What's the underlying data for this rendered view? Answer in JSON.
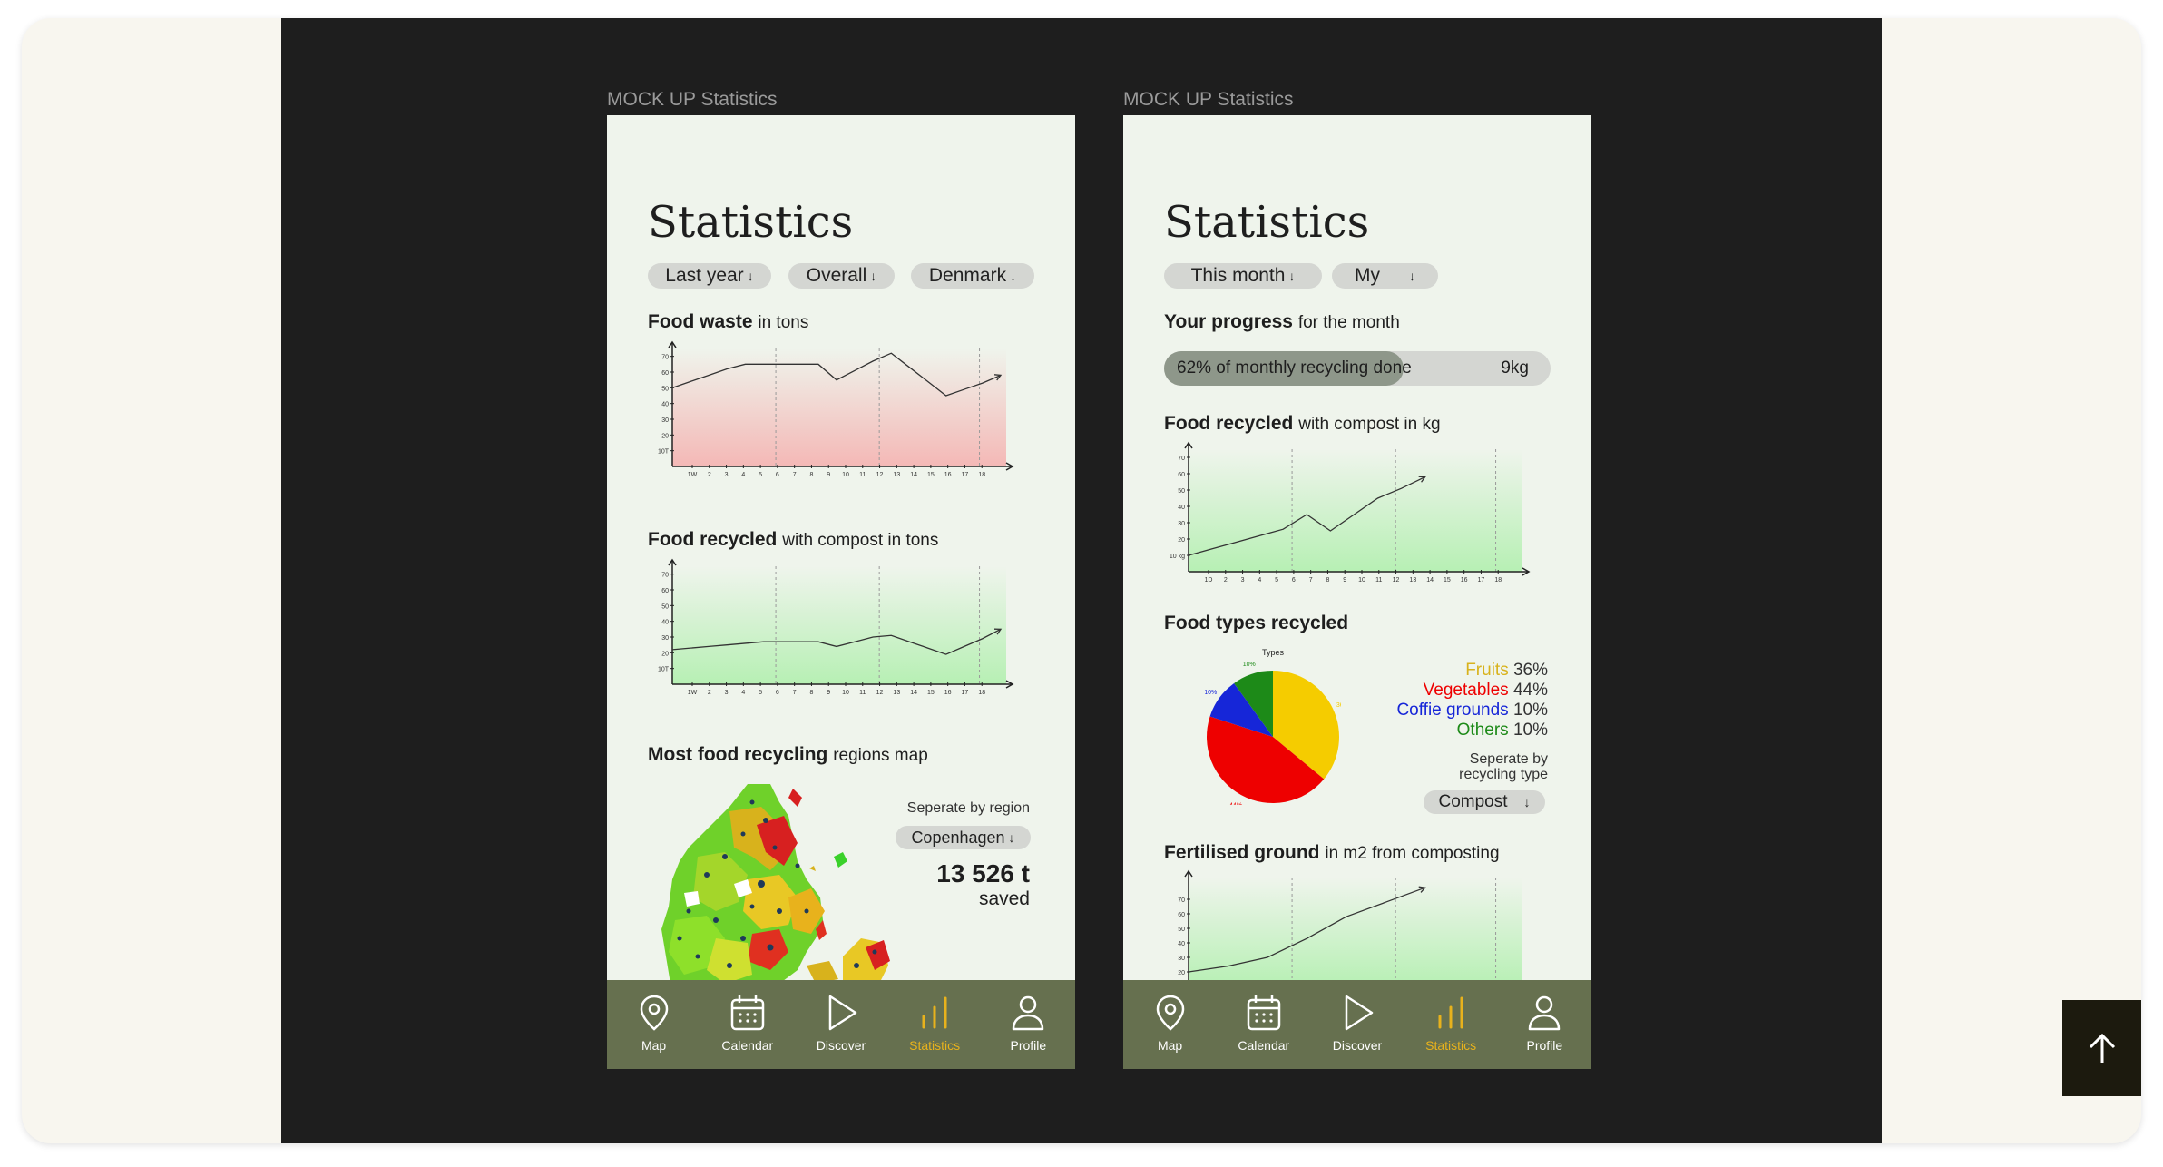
{
  "frame_label_left": "MOCK UP Statistics",
  "frame_label_right": "MOCK UP Statistics",
  "left": {
    "title": "Statistics",
    "filters": [
      "Last year",
      "Overall",
      "Denmark"
    ],
    "food_waste": {
      "title": "Food waste",
      "sub": "in tons"
    },
    "food_recycled": {
      "title": "Food recycled",
      "sub": "with compost in tons"
    },
    "map_section": {
      "title": "Most food recycling",
      "sub": "regions map",
      "separate_label": "Seperate by region",
      "region": "Copenhagen",
      "amount": "13 526 t",
      "amount_sub": "saved"
    }
  },
  "right": {
    "title": "Statistics",
    "filters": [
      "This month",
      "My"
    ],
    "progress": {
      "title": "Your progress",
      "sub": "for the month",
      "text": "62% of monthly recycling done",
      "value": "9kg",
      "percent": 62
    },
    "food_recycled": {
      "title": "Food recycled",
      "sub": "with compost in kg"
    },
    "food_types": {
      "title": "Food types recycled",
      "pie_title": "Types",
      "separate_label_1": "Seperate by",
      "separate_label_2": "recycling type",
      "select": "Compost"
    },
    "fertilised": {
      "title": "Fertilised ground",
      "sub": "in m2 from composting"
    }
  },
  "arrows": "↓",
  "tabs": [
    {
      "label": "Map",
      "icon": "map-pin-icon"
    },
    {
      "label": "Calendar",
      "icon": "calendar-icon"
    },
    {
      "label": "Discover",
      "icon": "play-icon"
    },
    {
      "label": "Statistics",
      "icon": "bar-chart-icon"
    },
    {
      "label": "Profile",
      "icon": "user-icon"
    }
  ],
  "colors": {
    "stage": "#1e1e1e",
    "phone": "#eff4ec",
    "tabbar": "#66704f",
    "active": "#e8b21c",
    "waste_fill": "#f4b8b6",
    "recycle_fill": "#b7f0b4"
  },
  "chart_data": [
    {
      "type": "area",
      "title": "Food waste",
      "ylabel": "",
      "yticks": [
        "10T",
        "20",
        "30",
        "40",
        "50",
        "60",
        "70"
      ],
      "x": [
        "1W",
        "2",
        "3",
        "4",
        "5",
        "6",
        "7",
        "8",
        "9",
        "10",
        "11",
        "12",
        "13",
        "14",
        "15",
        "16",
        "17",
        "18"
      ],
      "series": [
        {
          "values": [
            50,
            54,
            58,
            62,
            65,
            65,
            65,
            65,
            65,
            55,
            61,
            67,
            72,
            63,
            54,
            45,
            49,
            53,
            58
          ]
        }
      ],
      "ylim": [
        0,
        75
      ],
      "fill": "#f4b8b6"
    },
    {
      "type": "area",
      "title": "Food recycled",
      "yticks": [
        "10T",
        "20",
        "30",
        "40",
        "50",
        "60",
        "70"
      ],
      "x": [
        "1W",
        "2",
        "3",
        "4",
        "5",
        "6",
        "7",
        "8",
        "9",
        "10",
        "11",
        "12",
        "13",
        "14",
        "15",
        "16",
        "17",
        "18"
      ],
      "series": [
        {
          "values": [
            22,
            23,
            24,
            25,
            26,
            27,
            27,
            27,
            27,
            24,
            27,
            30,
            31,
            27,
            23,
            19,
            24,
            29,
            35
          ]
        }
      ],
      "ylim": [
        0,
        75
      ],
      "fill": "#b7f0b4"
    },
    {
      "type": "line",
      "title": "Food recycled",
      "yticks": [
        "10\nkg",
        "20",
        "30",
        "40",
        "50",
        "60",
        "70"
      ],
      "x": [
        "1D",
        "2",
        "3",
        "4",
        "5",
        "6",
        "7",
        "8",
        "9",
        "10",
        "11",
        "12",
        "13",
        "14",
        "15",
        "16",
        "17",
        "18"
      ],
      "series": [
        {
          "values": [
            10,
            14,
            18,
            22,
            26,
            35,
            25,
            35,
            45,
            51,
            58
          ]
        }
      ],
      "ylim": [
        0,
        75
      ],
      "fill": "#b7f0b4"
    },
    {
      "type": "pie",
      "title": "Types",
      "labels": [
        "Fruits",
        "Vegetables",
        "Coffie grounds",
        "Others"
      ],
      "values": [
        36,
        44,
        10,
        10
      ],
      "colors": [
        "#f5cc00",
        "#ee0000",
        "#1626d8",
        "#1d8a18"
      ]
    },
    {
      "type": "line",
      "title": "Fertilised ground",
      "yticks": [
        "20",
        "30",
        "40",
        "50",
        "60",
        "70"
      ],
      "series": [
        {
          "values": [
            10,
            14,
            20,
            33,
            48,
            58,
            68
          ]
        }
      ],
      "ylim": [
        0,
        75
      ],
      "fill": "#b7f0b4"
    }
  ]
}
